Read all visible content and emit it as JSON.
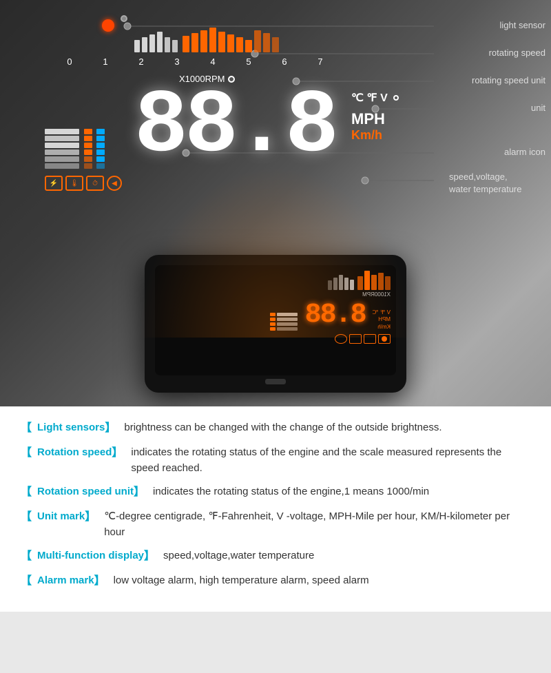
{
  "image": {
    "annotations": {
      "light_sensor": "light sensor",
      "rotating_speed": "rotating speed",
      "rotating_speed_unit": "rotating speed unit",
      "unit": "unit",
      "alarm_icon": "alarm icon",
      "speed_voltage_water": "speed,voltage,\nwater temperature"
    },
    "rpm": {
      "label": "X1000RPM",
      "numbers": [
        "0",
        "1",
        "2",
        "3",
        "4",
        "5",
        "6",
        "7"
      ]
    },
    "display": {
      "digits": "88.8",
      "temp_units": "℃ ℉ V",
      "mph": "MPH",
      "kmh": "Km/h"
    }
  },
  "info": [
    {
      "bracket_open": "【",
      "label": "Light sensors",
      "bracket_close": "】",
      "content": "brightness can be changed with the change of the outside brightness."
    },
    {
      "bracket_open": "【",
      "label": "Rotation speed",
      "bracket_close": "】",
      "content": "indicates the rotating status of the engine and the scale measured represents the speed reached."
    },
    {
      "bracket_open": "【",
      "label": "Rotation speed unit",
      "bracket_close": "】",
      "content": "indicates the rotating status of the engine,1 means 1000/min"
    },
    {
      "bracket_open": "【",
      "label": "Unit mark",
      "bracket_close": "】",
      "content": "℃-degree centigrade, ℉-Fahrenheit, V -voltage, MPH-Mile per hour, KM/H-kilometer per hour"
    },
    {
      "bracket_open": "【",
      "label": "Multi-function display",
      "bracket_close": "】",
      "content": "speed,voltage,water temperature"
    },
    {
      "bracket_open": "【",
      "label": "Alarm mark",
      "bracket_close": "】",
      "content": "low voltage alarm, high temperature alarm, speed alarm"
    }
  ]
}
